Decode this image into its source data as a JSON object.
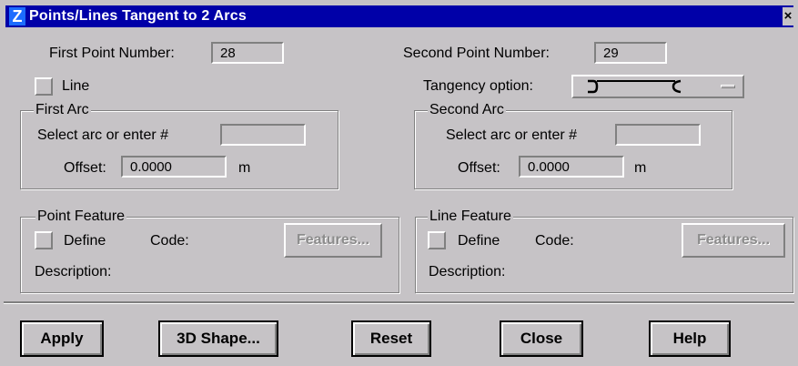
{
  "window": {
    "title": "Points/Lines Tangent to 2 Arcs",
    "close_glyph": "×",
    "app_icon_glyph": "Z"
  },
  "first_point": {
    "label": "First Point Number:",
    "value": "28"
  },
  "second_point": {
    "label": "Second Point Number:",
    "value": "29"
  },
  "line_toggle": {
    "label": "Line",
    "checked": false
  },
  "tangency": {
    "label": "Tangency option:",
    "value_glyph": "arc-arc tangent line"
  },
  "first_arc": {
    "group_title": "First Arc",
    "select_label": "Select arc or enter #",
    "select_value": "",
    "offset_label": "Offset:",
    "offset_value": "0.0000",
    "unit": "m"
  },
  "second_arc": {
    "group_title": "Second Arc",
    "select_label": "Select arc or enter #",
    "select_value": "",
    "offset_label": "Offset:",
    "offset_value": "0.0000",
    "unit": "m"
  },
  "point_feature": {
    "group_title": "Point Feature",
    "define_label": "Define",
    "code_label": "Code:",
    "features_button": "Features...",
    "description_label": "Description:"
  },
  "line_feature": {
    "group_title": "Line Feature",
    "define_label": "Define",
    "code_label": "Code:",
    "features_button": "Features...",
    "description_label": "Description:"
  },
  "buttons": {
    "apply": "Apply",
    "shape3d": "3D Shape...",
    "reset": "Reset",
    "close": "Close",
    "help": "Help"
  },
  "colors": {
    "titlebar": "#0000a8",
    "face": "#c6c3c6"
  }
}
